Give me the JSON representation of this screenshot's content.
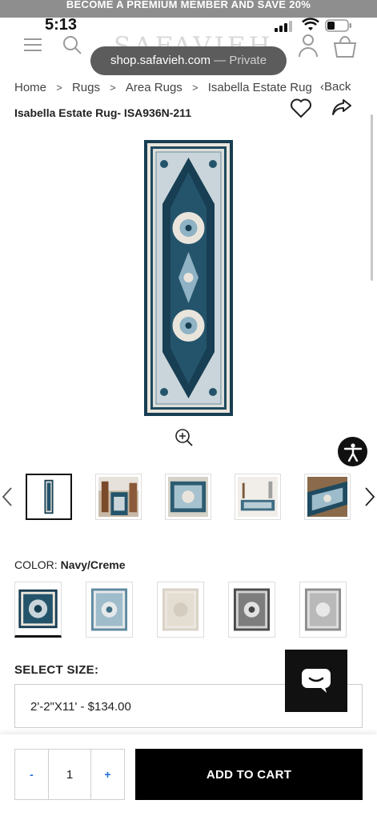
{
  "promo": {
    "text": "BECOME A PREMIUM MEMBER AND SAVE 20%"
  },
  "status_bar": {
    "time": "5:13"
  },
  "header": {
    "logo": "SAFAVIEH"
  },
  "browser": {
    "url": "shop.safavieh.com",
    "mode": "— Private"
  },
  "breadcrumb": {
    "items": [
      "Home",
      "Rugs",
      "Area Rugs",
      "Isabella Estate Rug"
    ],
    "separator": ">",
    "back_label": "Back"
  },
  "product": {
    "title": "Isabella Estate Rug- ISA936N-211",
    "colors": {
      "navy": "#173e52",
      "cream": "#e9e5dc",
      "light_blue": "#8fb3c4"
    }
  },
  "gallery": {
    "thumbnails": [
      "rug-front",
      "rug-room-1",
      "rug-detail",
      "rug-room-2",
      "rug-folded"
    ],
    "selected_index": 0
  },
  "color_selector": {
    "label": "COLOR:",
    "selected": "Navy/Creme",
    "swatches": [
      "Navy/Creme",
      "Light Blue",
      "Ivory",
      "Grey",
      "Silver"
    ]
  },
  "size_selector": {
    "label": "SELECT SIZE:",
    "selected": "2'-2\"X11' - $134.00"
  },
  "cart": {
    "minus": "-",
    "quantity": "1",
    "plus": "+",
    "add_label": "ADD TO CART"
  }
}
